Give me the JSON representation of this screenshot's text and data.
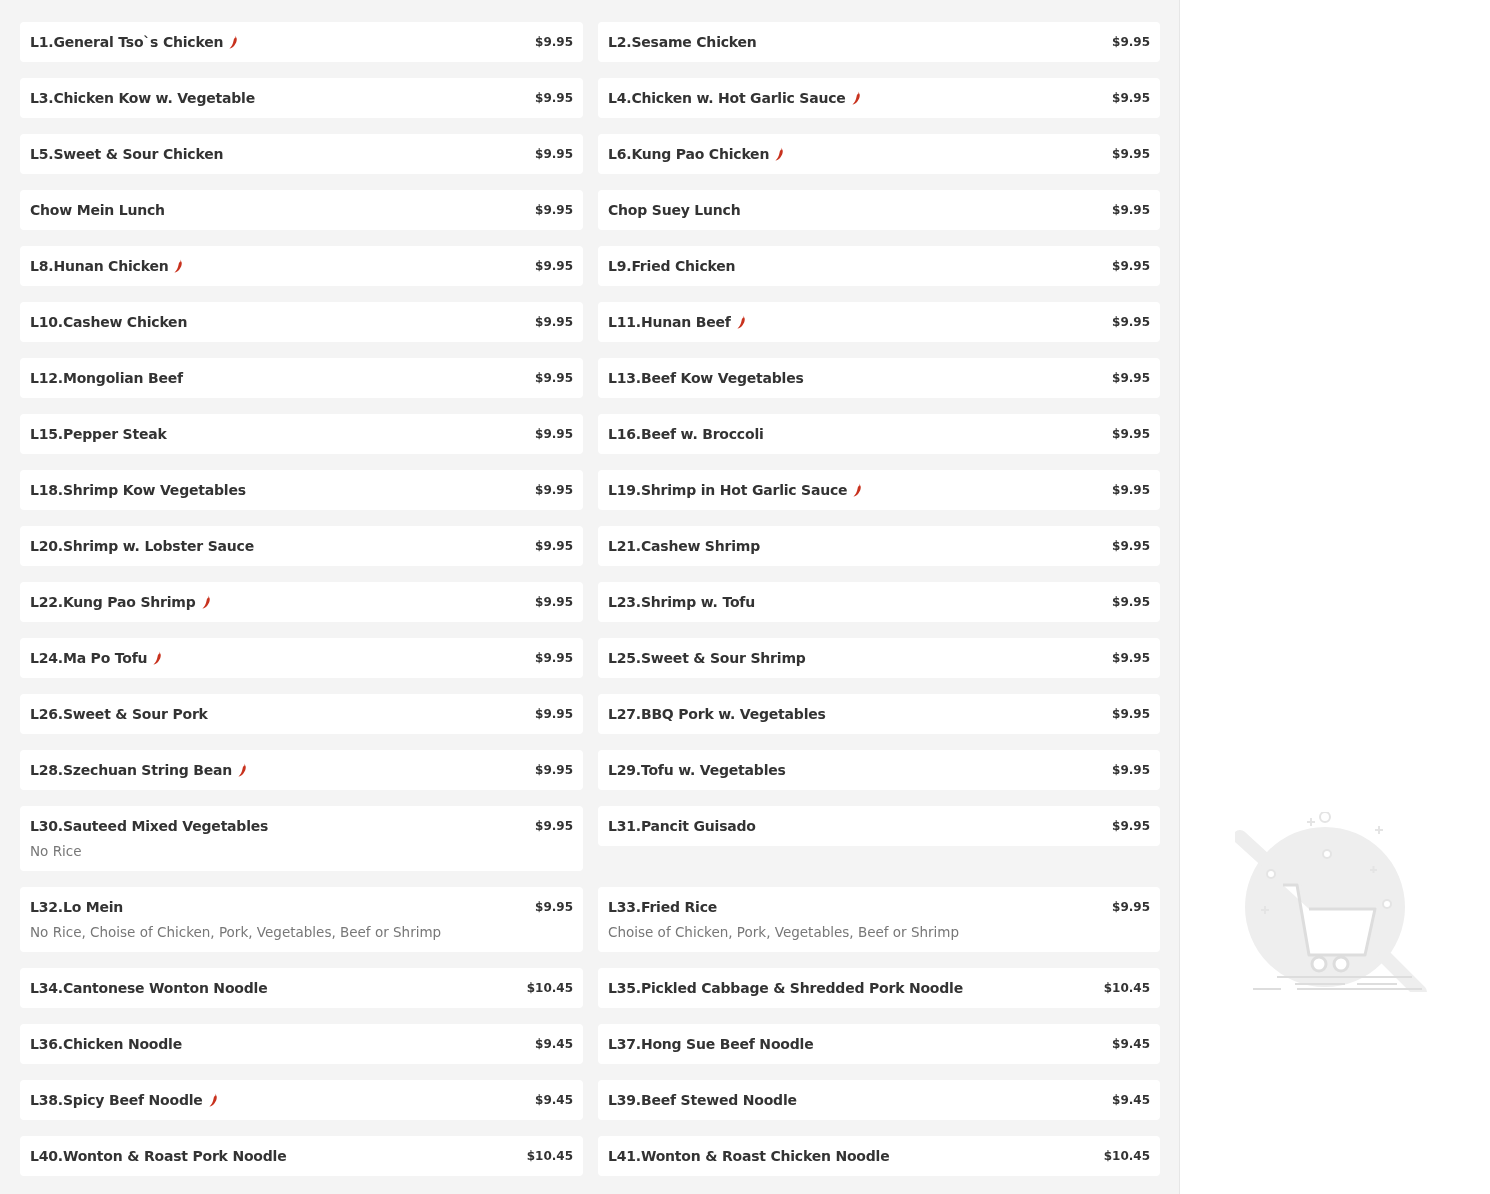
{
  "menu_items": [
    {
      "name": "L1.General Tso`s Chicken",
      "price": "$9.95",
      "spicy": true
    },
    {
      "name": "L2.Sesame Chicken",
      "price": "$9.95",
      "spicy": false
    },
    {
      "name": "L3.Chicken Kow w. Vegetable",
      "price": "$9.95",
      "spicy": false
    },
    {
      "name": "L4.Chicken w. Hot Garlic Sauce",
      "price": "$9.95",
      "spicy": true
    },
    {
      "name": "L5.Sweet & Sour Chicken",
      "price": "$9.95",
      "spicy": false
    },
    {
      "name": "L6.Kung Pao Chicken",
      "price": "$9.95",
      "spicy": true
    },
    {
      "name": "Chow Mein Lunch",
      "price": "$9.95",
      "spicy": false
    },
    {
      "name": "Chop Suey Lunch",
      "price": "$9.95",
      "spicy": false
    },
    {
      "name": "L8.Hunan Chicken",
      "price": "$9.95",
      "spicy": true
    },
    {
      "name": "L9.Fried Chicken",
      "price": "$9.95",
      "spicy": false
    },
    {
      "name": "L10.Cashew Chicken",
      "price": "$9.95",
      "spicy": false
    },
    {
      "name": "L11.Hunan Beef",
      "price": "$9.95",
      "spicy": true
    },
    {
      "name": "L12.Mongolian Beef",
      "price": "$9.95",
      "spicy": false
    },
    {
      "name": "L13.Beef Kow Vegetables",
      "price": "$9.95",
      "spicy": false
    },
    {
      "name": "L15.Pepper Steak",
      "price": "$9.95",
      "spicy": false
    },
    {
      "name": "L16.Beef w. Broccoli",
      "price": "$9.95",
      "spicy": false
    },
    {
      "name": "L18.Shrimp Kow Vegetables",
      "price": "$9.95",
      "spicy": false
    },
    {
      "name": "L19.Shrimp in Hot Garlic Sauce",
      "price": "$9.95",
      "spicy": true
    },
    {
      "name": "L20.Shrimp w. Lobster Sauce",
      "price": "$9.95",
      "spicy": false
    },
    {
      "name": "L21.Cashew Shrimp",
      "price": "$9.95",
      "spicy": false
    },
    {
      "name": "L22.Kung Pao Shrimp",
      "price": "$9.95",
      "spicy": true
    },
    {
      "name": "L23.Shrimp w. Tofu",
      "price": "$9.95",
      "spicy": false
    },
    {
      "name": "L24.Ma Po Tofu",
      "price": "$9.95",
      "spicy": true
    },
    {
      "name": "L25.Sweet & Sour Shrimp",
      "price": "$9.95",
      "spicy": false
    },
    {
      "name": "L26.Sweet & Sour Pork",
      "price": "$9.95",
      "spicy": false
    },
    {
      "name": "L27.BBQ Pork w. Vegetables",
      "price": "$9.95",
      "spicy": false
    },
    {
      "name": "L28.Szechuan String Bean",
      "price": "$9.95",
      "spicy": true
    },
    {
      "name": "L29.Tofu w. Vegetables",
      "price": "$9.95",
      "spicy": false
    },
    {
      "name": "L30.Sauteed Mixed Vegetables",
      "price": "$9.95",
      "spicy": false,
      "description": "No Rice"
    },
    {
      "name": "L31.Pancit Guisado",
      "price": "$9.95",
      "spicy": false
    },
    {
      "name": "L32.Lo Mein",
      "price": "$9.95",
      "spicy": false,
      "description": "No Rice, Choise of Chicken, Pork, Vegetables, Beef or Shrimp"
    },
    {
      "name": "L33.Fried Rice",
      "price": "$9.95",
      "spicy": false,
      "description": "Choise of Chicken, Pork, Vegetables, Beef or Shrimp"
    },
    {
      "name": "L34.Cantonese Wonton Noodle",
      "price": "$10.45",
      "spicy": false
    },
    {
      "name": "L35.Pickled Cabbage & Shredded Pork Noodle",
      "price": "$10.45",
      "spicy": false
    },
    {
      "name": "L36.Chicken Noodle",
      "price": "$9.45",
      "spicy": false
    },
    {
      "name": "L37.Hong Sue Beef Noodle",
      "price": "$9.45",
      "spicy": false
    },
    {
      "name": "L38.Spicy Beef Noodle",
      "price": "$9.45",
      "spicy": true
    },
    {
      "name": "L39.Beef Stewed Noodle",
      "price": "$9.45",
      "spicy": false
    },
    {
      "name": "L40.Wonton & Roast Pork Noodle",
      "price": "$10.45",
      "spicy": false
    },
    {
      "name": "L41.Wonton & Roast Chicken Noodle",
      "price": "$10.45",
      "spicy": false
    }
  ]
}
